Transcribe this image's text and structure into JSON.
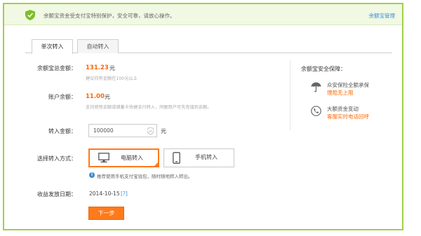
{
  "banner": {
    "text": "余额宝资金受支付宝特别保护，安全可靠，请放心操作。",
    "manage_link": "余额宝管理"
  },
  "tabs": [
    {
      "label": "单次转入",
      "active": true
    },
    {
      "label": "自动转入",
      "active": false
    }
  ],
  "form": {
    "total": {
      "label": "余额宝总金额：",
      "value": "131.23",
      "unit": "元",
      "hint": "建议持有金额在100元以上"
    },
    "balance": {
      "label": "账户余额：",
      "value": "11.00",
      "unit": "元",
      "hint": "支持使用余额或储蓄卡快捷支付转入，同额用户可先充值到余额。"
    },
    "transfer": {
      "label": "转入金额：",
      "input_value": "100000",
      "unit": "元"
    },
    "method": {
      "label": "选择转入方式：",
      "options": [
        {
          "label": "电脑转入",
          "icon": "monitor-icon",
          "selected": true
        },
        {
          "label": "手机转入",
          "icon": "phone-icon",
          "selected": false
        }
      ],
      "info_icon": "i",
      "info": "推荐使用手机支付宝钱包，随时随地转入转出。"
    },
    "date": {
      "label": "收益发放日期：",
      "value": "2014-10-15",
      "help": "[?]"
    },
    "next_button": "下一步"
  },
  "side": {
    "title": "余额宝安全保障：",
    "items": [
      {
        "icon": "umbrella-icon",
        "line1": "众安保险全额承保",
        "line2": "理赔无上限"
      },
      {
        "icon": "phone-24h-icon",
        "line1": "大额资金变动",
        "line2": "客服实时电话回呼"
      }
    ]
  },
  "colors": {
    "accent": "#ff7a1a",
    "frame": "#9fd04a",
    "link": "#3b8fd2",
    "amount": "#ff6600"
  }
}
